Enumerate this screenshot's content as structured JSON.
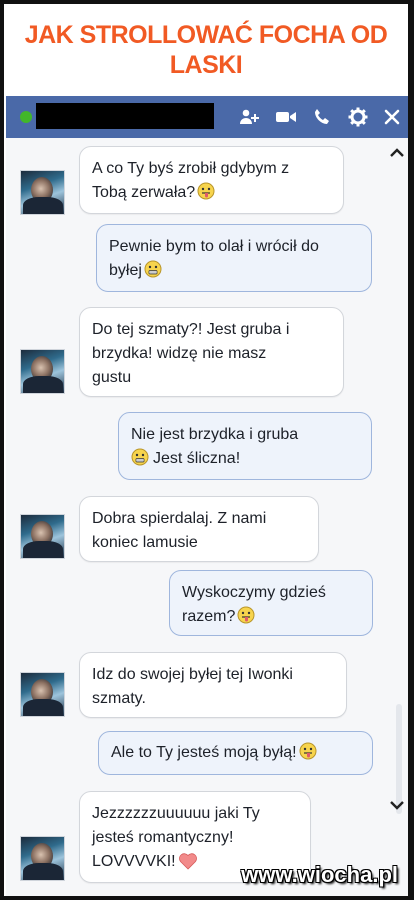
{
  "headline": {
    "line1": "JAK STROLLOWAĆ FOCHA OD",
    "line2": "LASKI",
    "color": "#f15a24"
  },
  "chat_header": {
    "background": "#4a69a8",
    "icons": [
      "add-friend-icon",
      "video-call-icon",
      "phone-icon",
      "gear-icon",
      "close-icon"
    ]
  },
  "messages": [
    {
      "side": "in",
      "lines": [
        "A co Ty byś zrobił gdybym z",
        "Tobą zerwała?"
      ],
      "emoji": "tongue-face"
    },
    {
      "side": "out",
      "lines": [
        "Pewnie bym to olał i wrócił do",
        "byłej"
      ],
      "emoji": "grin-face"
    },
    {
      "side": "in",
      "lines": [
        "Do tej szmaty?! Jest gruba i",
        "brzydka! widzę nie masz",
        "gustu"
      ]
    },
    {
      "side": "out",
      "lines": [
        "Nie jest brzydka i gruba",
        "Jest śliczna!"
      ],
      "emoji": "grin-face"
    },
    {
      "side": "in",
      "lines": [
        "Dobra spierdalaj. Z nami",
        "koniec lamusie"
      ]
    },
    {
      "side": "out",
      "lines": [
        "Wyskoczymy gdzieś",
        "razem?"
      ],
      "emoji": "tongue-face"
    },
    {
      "side": "in",
      "lines": [
        "Idz do swojej byłej tej Iwonki",
        "szmaty."
      ]
    },
    {
      "side": "out",
      "lines": [
        "Ale to Ty jesteś moją byłą!"
      ],
      "emoji": "tongue-face"
    },
    {
      "side": "in",
      "lines": [
        "Jezzzzzzuuuuuu jaki Ty",
        "jesteś romantyczny!",
        "LOVVVVKI!"
      ],
      "emoji": "heart"
    }
  ],
  "watermark": "www.wiocha.pl"
}
